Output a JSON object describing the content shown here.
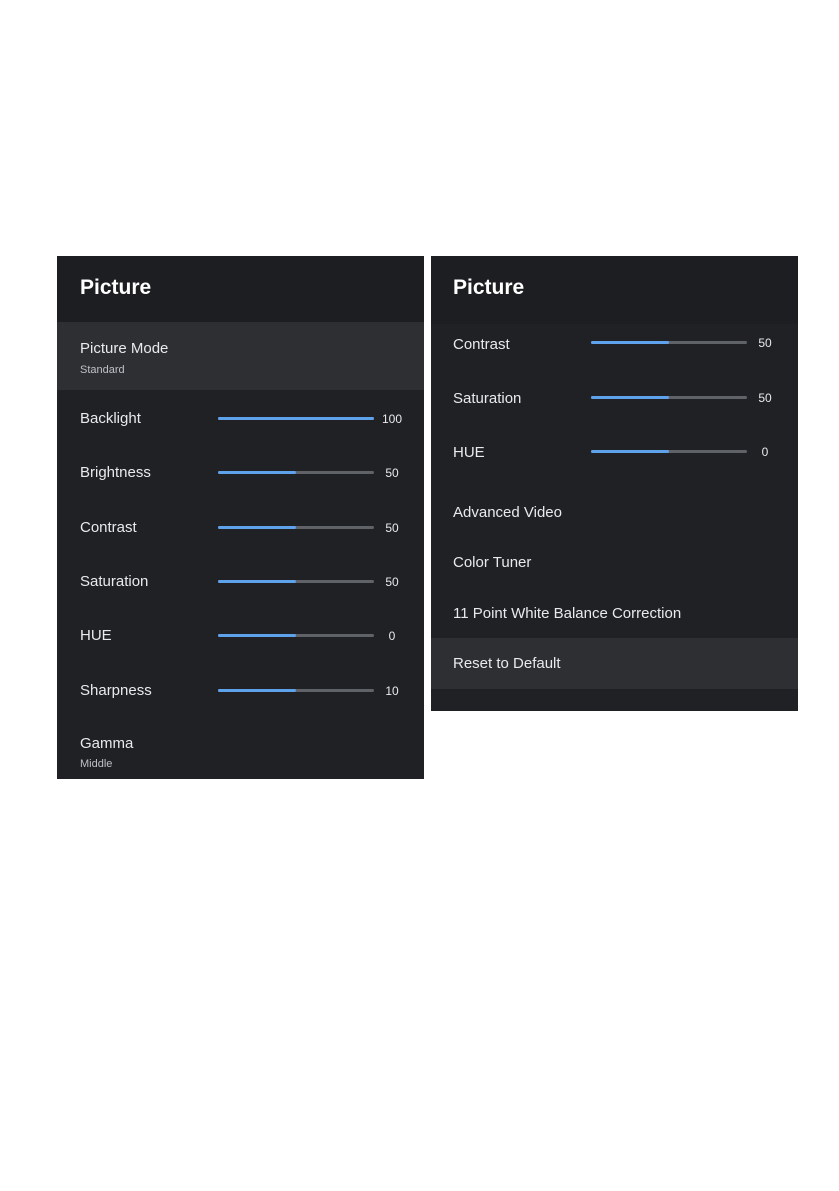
{
  "left_panel": {
    "title": "Picture",
    "picture_mode": {
      "label": "Picture Mode",
      "value": "Standard"
    },
    "sliders": [
      {
        "label": "Backlight",
        "value": "100",
        "level": 1.0
      },
      {
        "label": "Brightness",
        "value": "50",
        "level": 0.5
      },
      {
        "label": "Contrast",
        "value": "50",
        "level": 0.5
      },
      {
        "label": "Saturation",
        "value": "50",
        "level": 0.5
      },
      {
        "label": "HUE",
        "value": "0",
        "level": 0.5
      },
      {
        "label": "Sharpness",
        "value": "10",
        "level": 0.5
      }
    ],
    "gamma": {
      "label": "Gamma",
      "value": "Middle"
    }
  },
  "right_panel": {
    "title": "Picture",
    "sliders": [
      {
        "label": "Contrast",
        "value": "50",
        "level": 0.5
      },
      {
        "label": "Saturation",
        "value": "50",
        "level": 0.5
      },
      {
        "label": "HUE",
        "value": "0",
        "level": 0.5
      }
    ],
    "menu_items": [
      {
        "label": "Advanced Video"
      },
      {
        "label": "Color Tuner"
      },
      {
        "label": "11 Point White Balance Correction"
      },
      {
        "label": "Reset to Default"
      }
    ]
  },
  "colors": {
    "panel_background": "#202124",
    "selected_row": "#2e2f33",
    "slider_fill": "#5ea2ec",
    "slider_track": "#5f6368"
  }
}
